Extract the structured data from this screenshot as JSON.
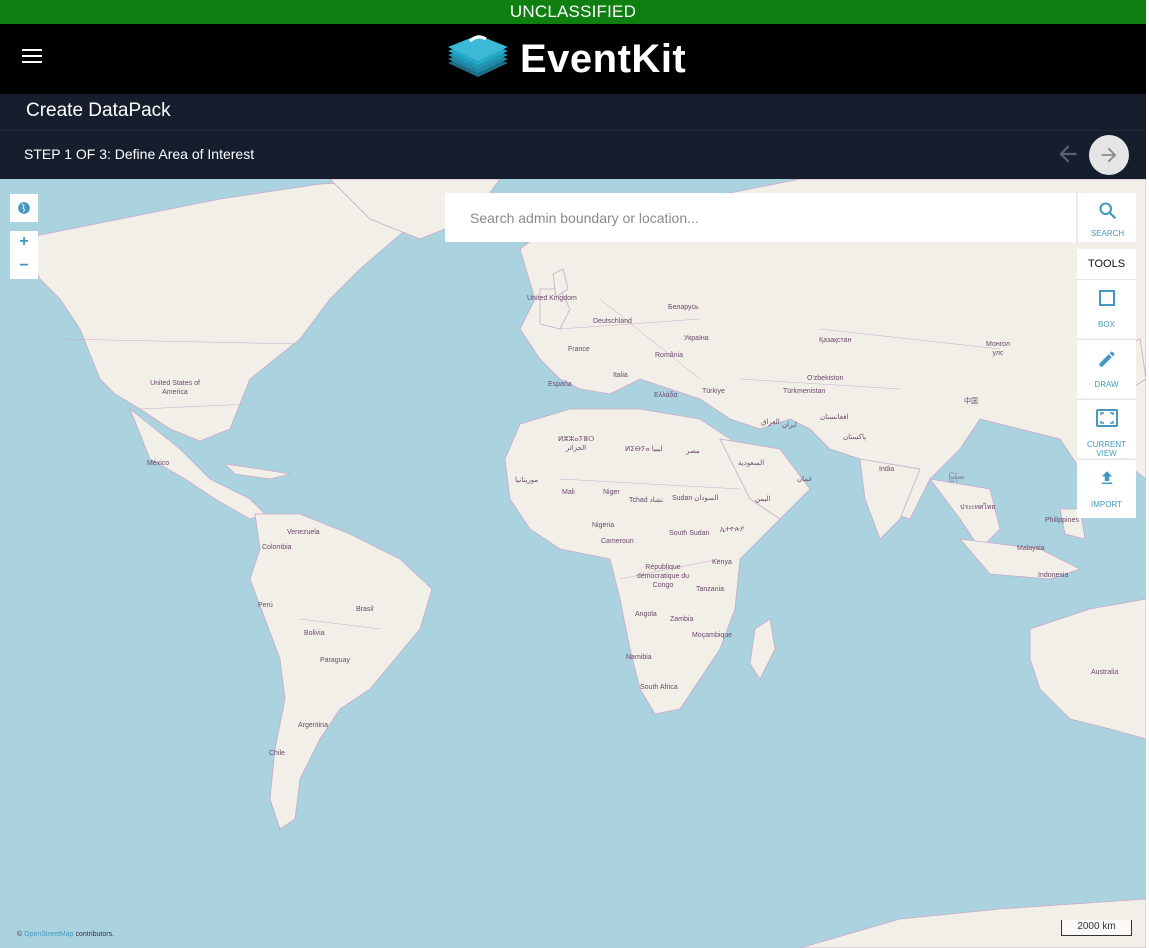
{
  "banner": {
    "text": "UNCLASSIFIED",
    "color": "#0f7f12"
  },
  "header": {
    "app_name": "EventKit",
    "menu_icon": "hamburger-icon"
  },
  "page": {
    "title": "Create DataPack",
    "step_label": "STEP 1 OF 3: Define Area of Interest"
  },
  "map": {
    "search_placeholder": "Search admin boundary or location...",
    "search_label": "SEARCH",
    "tools_label": "TOOLS",
    "tools": [
      {
        "label": "BOX",
        "icon": "square-icon"
      },
      {
        "label": "DRAW",
        "icon": "pencil-icon"
      },
      {
        "label": "CURRENT VIEW",
        "icon": "viewport-icon"
      },
      {
        "label": "IMPORT",
        "icon": "upload-icon"
      }
    ],
    "zoom_in": "+",
    "zoom_out": "−",
    "attribution": {
      "prefix": "©",
      "link": "OpenStreetMap",
      "suffix": "contributors."
    },
    "scale": "2000 km",
    "labels": [
      {
        "text": "United Kingdom"
      },
      {
        "text": "Deutschland"
      },
      {
        "text": "Беларусь"
      },
      {
        "text": "France"
      },
      {
        "text": "Україна"
      },
      {
        "text": "România"
      },
      {
        "text": "España"
      },
      {
        "text": "Italia"
      },
      {
        "text": "Ελλάδα"
      },
      {
        "text": "Türkiye"
      },
      {
        "text": "Қазақстан"
      },
      {
        "text": "Монгол улс"
      },
      {
        "text": "O'zbekiston"
      },
      {
        "text": "Türkmenistan"
      },
      {
        "text": "中国"
      },
      {
        "text": "United States of America"
      },
      {
        "text": "México"
      },
      {
        "text": "ⵍⵣⵣⴰⵢⴻⵔ الجزائر"
      },
      {
        "text": "ⵍⵉⴱⵢⴰ ليبيا"
      },
      {
        "text": "مصر"
      },
      {
        "text": "السعودية"
      },
      {
        "text": "العراق"
      },
      {
        "text": "ایران"
      },
      {
        "text": "افغانستان"
      },
      {
        "text": "پاکستان"
      },
      {
        "text": "India"
      },
      {
        "text": "موريتانيا"
      },
      {
        "text": "Mali"
      },
      {
        "text": "Niger"
      },
      {
        "text": "Tchad تشاد"
      },
      {
        "text": "Sudan السودان"
      },
      {
        "text": "اليمن"
      },
      {
        "text": "عمان"
      },
      {
        "text": "ኢትዮጵያ"
      },
      {
        "text": "Nigeria"
      },
      {
        "text": "Cameroun"
      },
      {
        "text": "South Sudan"
      },
      {
        "text": "Venezuela"
      },
      {
        "text": "Colombia"
      },
      {
        "text": "République démocratique du Congo"
      },
      {
        "text": "Kenya"
      },
      {
        "text": "Tanzania"
      },
      {
        "text": "Perú"
      },
      {
        "text": "Brasil"
      },
      {
        "text": "Bolivia"
      },
      {
        "text": "Angola"
      },
      {
        "text": "Zambia"
      },
      {
        "text": "Moçambique"
      },
      {
        "text": "Paraguay"
      },
      {
        "text": "Namibia"
      },
      {
        "text": "South Africa"
      },
      {
        "text": "Argentina"
      },
      {
        "text": "Chile"
      },
      {
        "text": "Philippines"
      },
      {
        "text": "Malaysia"
      },
      {
        "text": "Indonesia"
      },
      {
        "text": "Australia"
      },
      {
        "text": "ประเทศไทย"
      },
      {
        "text": "မြန်မာ"
      }
    ]
  }
}
